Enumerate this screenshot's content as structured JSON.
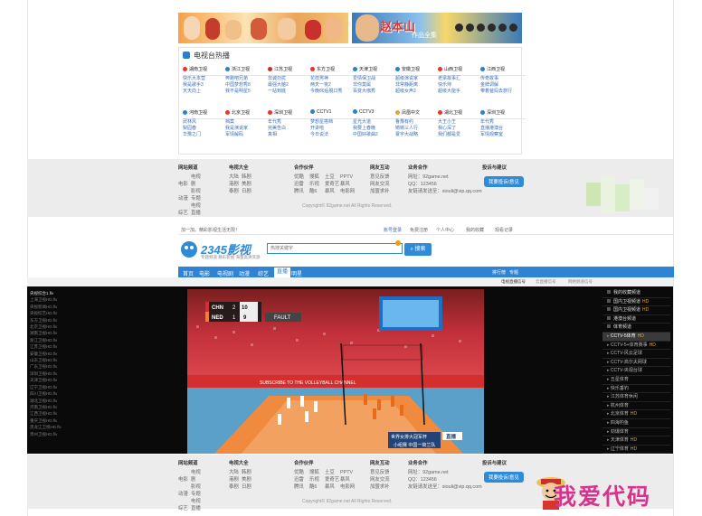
{
  "site1": {
    "banners": [
      {
        "text": "",
        "sub": ""
      },
      {
        "text": "赵本山",
        "sub": "作品全集"
      }
    ],
    "tv_section_title": "电视台热播",
    "channels_row1": [
      {
        "name": "湖南卫视",
        "color": "#e8342c",
        "items": [
          "快乐大本营",
          "我是歌手3",
          "天天向上"
        ]
      },
      {
        "name": "浙江卫视",
        "color": "#2b7fd1",
        "items": [
          "奔跑吧兄弟",
          "中国梦想秀8",
          "我不是明星5"
        ]
      },
      {
        "name": "江苏卫视",
        "color": "#c9302c",
        "items": [
          "非诚勿扰",
          "最强大脑2",
          "一站到底"
        ]
      },
      {
        "name": "东方卫视",
        "color": "#e8342c",
        "items": [
          "花样男神",
          "两天一夜2",
          "今晚80后脱口秀"
        ]
      },
      {
        "name": "天津卫视",
        "color": "#2b7fd1",
        "items": [
          "爱情保卫战",
          "非你莫属",
          "百变大咖秀"
        ]
      },
      {
        "name": "安徽卫视",
        "color": "#2b7fd1",
        "items": [
          "超级演说家",
          "非常静距离",
          "超级女声2"
        ]
      },
      {
        "name": "山西卫视",
        "color": "#e8342c",
        "items": [
          "老梁故事汇",
          "快乐帅",
          "超级大能手"
        ]
      },
      {
        "name": "江西卫视",
        "color": "#2b7fd1",
        "items": [
          "传奇故事",
          "金牌调解",
          "带着爸妈去旅行"
        ]
      }
    ],
    "channels_row2": [
      {
        "name": "河南卫视",
        "color": "#2b7fd1",
        "items": [
          "武林风",
          "梨园春",
          "华豫之门"
        ]
      },
      {
        "name": "北京卫视",
        "color": "#e8342c",
        "items": [
          "档案",
          "我是演说家",
          "军情解码"
        ]
      },
      {
        "name": "深圳卫视",
        "color": "#e8342c",
        "items": [
          "年代秀",
          "完美告白",
          "真相"
        ]
      },
      {
        "name": "CCTV1",
        "color": "#2b7fd1",
        "items": [
          "梦想星搭档",
          "开讲啦",
          "今日说法"
        ]
      },
      {
        "name": "CCTV3",
        "color": "#2b7fd1",
        "items": [
          "星光大道",
          "我要上春晚",
          "中国好歌曲2"
        ]
      },
      {
        "name": "凤凰中文",
        "color": "#e5a23b",
        "items": [
          "鲁豫有约",
          "锵锵三人行",
          "寰宇大战略"
        ]
      },
      {
        "name": "湖北卫视",
        "color": "#e8342c",
        "items": [
          "大王小王",
          "我心深了",
          "我们都是爱"
        ]
      },
      {
        "name": "深圳卫视",
        "color": "#2b7fd1",
        "items": [
          "年代秀",
          "直播港澳台",
          "军情观察室"
        ]
      }
    ]
  },
  "footer": {
    "cols": [
      {
        "title": "网站频道",
        "items": [
          "电影",
          "电视剧",
          "动漫",
          "影视专题",
          "综艺",
          "电视直播"
        ]
      },
      {
        "title": "电视大全",
        "items": [
          "大陆",
          "韩剧",
          "港剧",
          "美剧",
          "泰剧",
          "日剧"
        ]
      },
      {
        "title": "合作伙伴",
        "items": [
          "优酷",
          "搜狐",
          "土豆",
          "PPTV",
          "迅雷",
          "乐视",
          "爱奇艺",
          "暴风",
          "腾讯",
          "酷6",
          "暴风",
          "电影网"
        ]
      },
      {
        "title": "网友互动",
        "items": [
          "意见反馈",
          "网友交流",
          "加盟求补"
        ]
      },
      {
        "title": "业务合作",
        "items": [
          "网址：92game.net",
          "QQ：123456",
          "友链请发送至：xiouli@vip.qq.com"
        ]
      }
    ],
    "feedback_title": "投诉与建议",
    "feedback_button": "我要投诉/意见",
    "copyright": "Copyright© 92game.net All Rights Reserved."
  },
  "site2": {
    "topbar_left": "加一加。精彩影视生活无限！",
    "topbar_right": [
      "账号登录",
      "免费注册",
      "个人中心",
      "我的收藏",
      "观看记录"
    ],
    "logo_text": "2345影视",
    "logo_sub": "专题频道 精彩影视 海量高清资源",
    "search_placeholder": "热搜关键字",
    "search_button": "搜索",
    "nav": [
      "首页",
      "电影",
      "电视剧",
      "动漫",
      "综艺",
      "直播",
      "明星"
    ],
    "nav_right": [
      "排行榜",
      "专题"
    ],
    "subbar_right": [
      "电视直播信号",
      "云直播信号",
      "网络频道信号"
    ],
    "left_list": [
      "央视综合1.flv",
      "上海卫视HD.flv",
      "央视新闻HD.flv",
      "央视综艺HD.flv",
      "东方卫视HD.flv",
      "北京卫视HD.flv",
      "湖南卫视HD.flv",
      "浙江卫视HD.flv",
      "江苏卫视HD.flv",
      "安徽卫视HD.flv",
      "山东卫视HD.flv",
      "广东卫视HD.flv",
      "深圳卫视HD.flv",
      "天津卫视HD.flv",
      "辽宁卫视HD.flv",
      "四川卫视HD.flv",
      "湖北卫视HD.flv",
      "河南卫视HD.flv",
      "江西卫视HD.flv",
      "重庆卫视HD.flv",
      "黑龙江卫视HD.flv",
      "贵州卫视HD.flv"
    ],
    "right_groups": [
      {
        "type": "hd",
        "label": "我的收藏频道"
      },
      {
        "type": "hd",
        "label": "国内卫视频道",
        "tag": "HD"
      },
      {
        "type": "hd",
        "label": "国内卫视频道",
        "tag": "HD"
      },
      {
        "type": "hd",
        "label": "港澳台频道"
      },
      {
        "type": "hd",
        "label": "体育频道"
      },
      {
        "type": "item",
        "label": "CCTV-5体育",
        "tag": "HD",
        "active": true
      },
      {
        "type": "item",
        "label": "CCTV-5+体育赛事",
        "tag": "HD"
      },
      {
        "type": "item",
        "label": "CCTV-风云足球"
      },
      {
        "type": "item",
        "label": "CCTV-高尔夫网球"
      },
      {
        "type": "item",
        "label": "CCTV-央视台球"
      },
      {
        "type": "item",
        "label": "五星体育"
      },
      {
        "type": "item",
        "label": "快乐垂钓"
      },
      {
        "type": "item",
        "label": "江苏体育休闲"
      },
      {
        "type": "item",
        "label": "杭州体育"
      },
      {
        "type": "item",
        "label": "北京体育",
        "tag": "HD"
      },
      {
        "type": "item",
        "label": "四海钓鱼"
      },
      {
        "type": "item",
        "label": "劲爆体育"
      },
      {
        "type": "item",
        "label": "天津体育",
        "tag": "HD"
      },
      {
        "type": "item",
        "label": "辽宁体育",
        "tag": "HD"
      },
      {
        "type": "item",
        "label": "广东体育"
      }
    ],
    "video": {
      "score_left_team": "CHN",
      "score_right_team": "NED",
      "score_a": "2",
      "score_b": "1",
      "score_c": "10",
      "score_d": "9",
      "fault_text": "FAULT",
      "caption_title": "世界女排大冠军杯",
      "caption_sub": "小组赛 中国一荷兰队",
      "live_tag": "直播",
      "courtside": "SUBSCRIBE TO THE VOLLEYBALL CHANNEL"
    }
  },
  "watermark": "我爱代码"
}
